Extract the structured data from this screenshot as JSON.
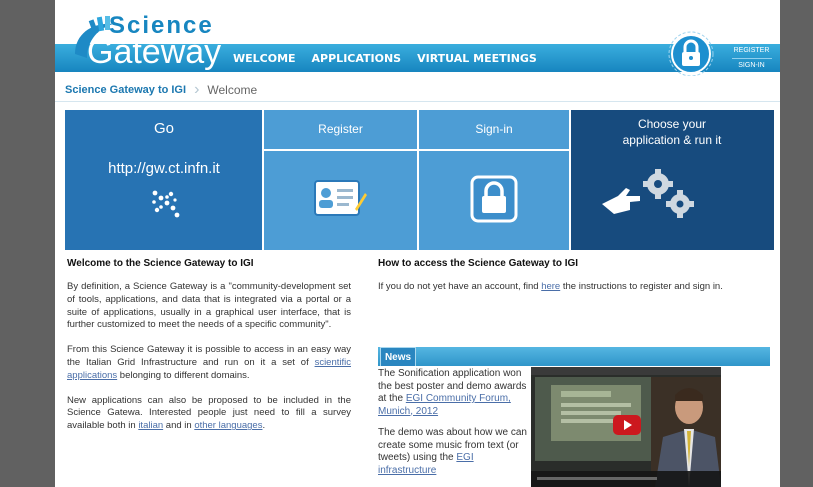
{
  "header": {
    "logo_top": "Science",
    "logo_bottom": "Gateway",
    "nav": [
      "WELCOME",
      "APPLICATIONS",
      "VIRTUAL MEETINGS"
    ],
    "register_label": "REGISTER",
    "signin_label": "SIGN-IN"
  },
  "breadcrumb": {
    "root": "Science Gateway to IGI",
    "current": "Welcome"
  },
  "tiles": {
    "go_label": "Go",
    "go_url": "http://gw.ct.infn.it",
    "register": "Register",
    "signin": "Sign-in",
    "choose_line1": "Choose your",
    "choose_line2": "application & run it"
  },
  "welcome": {
    "title": "Welcome to the Science Gateway to IGI",
    "p1": "By definition, a Science Gateway is a \"community-development set of tools, applications, and data that is integrated via a portal or a suite of applications, usually in a graphical user interface, that is further customized to meet the needs of a specific community\".",
    "p2_before": "From this Science Gateway it is possible to access in an easy way the Italian Grid Infrastructure and run on it a set of ",
    "p2_link": "scientific applications",
    "p2_after": " belonging to different domains.",
    "p3_before": "New applications can also be proposed to be included in the Science Gatewa. Interested people just need to fill a survey available both in ",
    "p3_link1": "italian",
    "p3_mid": " and in ",
    "p3_link2": "other languages",
    "p3_after": "."
  },
  "access": {
    "title": "How to access the Science Gateway to IGI",
    "text_before": "If you do not yet have an account, find ",
    "link": "here",
    "text_after": " the instructions to register and sign in."
  },
  "news": {
    "tab": "News",
    "p1_before": "The Sonification application won the best poster and demo awards at the ",
    "p1_link": "EGI Community Forum, Munich, 2012",
    "p2_before": "The demo was about how we can create some music from text (or tweets) using the ",
    "p2_link": "EGI infrastructure"
  },
  "colors": {
    "header_bar": "#1785bf",
    "tile_dark": "#2773b3",
    "tile_light": "#4d9dd5",
    "tile_navy": "#174b7e",
    "link": "#4a6ea8"
  }
}
